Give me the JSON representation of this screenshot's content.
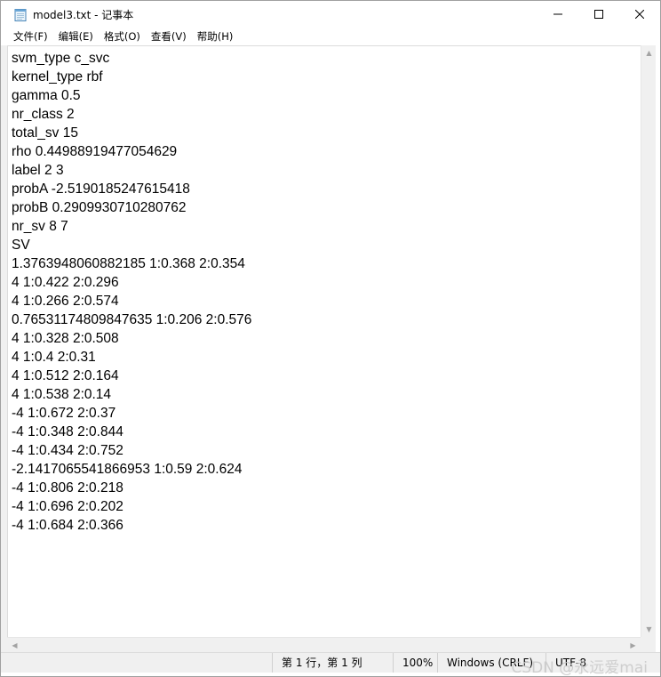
{
  "window": {
    "title": "model3.txt - 记事本",
    "icon": "notepad-icon"
  },
  "menu": [
    {
      "label": "文件(F)"
    },
    {
      "label": "编辑(E)"
    },
    {
      "label": "格式(O)"
    },
    {
      "label": "查看(V)"
    },
    {
      "label": "帮助(H)"
    }
  ],
  "document": {
    "lines": [
      "svm_type c_svc",
      "kernel_type rbf",
      "gamma 0.5",
      "nr_class 2",
      "total_sv 15",
      "rho 0.44988919477054629",
      "label 2 3",
      "probA -2.5190185247615418",
      "probB 0.2909930710280762",
      "nr_sv 8 7",
      "SV",
      "1.3763948060882185 1:0.368 2:0.354",
      "4 1:0.422 2:0.296",
      "4 1:0.266 2:0.574",
      "0.76531174809847635 1:0.206 2:0.576",
      "4 1:0.328 2:0.508",
      "4 1:0.4 2:0.31",
      "4 1:0.512 2:0.164",
      "4 1:0.538 2:0.14",
      "-4 1:0.672 2:0.37",
      "-4 1:0.348 2:0.844",
      "-4 1:0.434 2:0.752",
      "-2.1417065541866953 1:0.59 2:0.624",
      "-4 1:0.806 2:0.218",
      "-4 1:0.696 2:0.202",
      "-4 1:0.684 2:0.366"
    ]
  },
  "status": {
    "position": "第 1 行，第 1 列",
    "zoom": "100%",
    "line_ending": "Windows (CRLF)",
    "encoding": "UTF-8"
  },
  "watermark": "CSDN @永远爱mai"
}
